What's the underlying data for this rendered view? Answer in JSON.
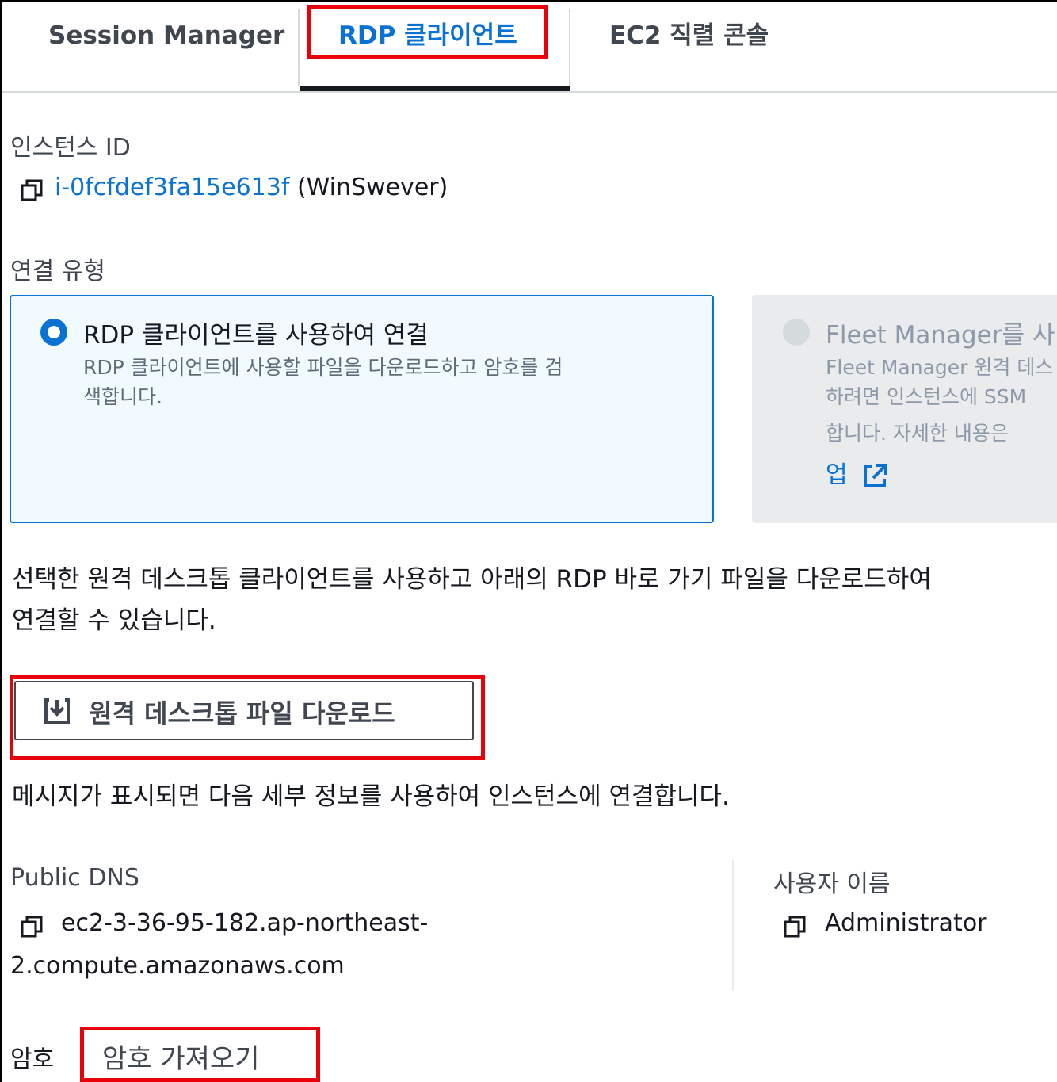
{
  "tabs": [
    {
      "label": "Session Manager"
    },
    {
      "label": "RDP 클라이언트"
    },
    {
      "label": "EC2 직렬 콘솔"
    }
  ],
  "instance": {
    "label": "인스턴스 ID",
    "id": "i-0fcfdef3fa15e613f",
    "name": "(WinSwever)"
  },
  "connection": {
    "label": "연결 유형",
    "option_rdp": {
      "title": "RDP 클라이언트를 사용하여 연결",
      "desc_line1": "RDP 클라이언트에 사용할 파일을 다운로드하고 암호를 검",
      "desc_line2": "색합니다."
    },
    "option_fleet": {
      "title": "Fleet Manager를 사",
      "desc_line1": "Fleet Manager 원격 데스",
      "desc_line2": "하려면 인스턴스에 SSM",
      "desc_line3": "합니다. 자세한 내용은 ",
      "link": "업"
    }
  },
  "instructions": {
    "line1": "선택한 원격 데스크톱 클라이언트를 사용하고 아래의 RDP 바로 가기 파일을 다운로드하여",
    "line2": "연결할 수 있습니다."
  },
  "download_button": {
    "label": "원격 데스크톱 파일 다운로드",
    "icon": "download-icon"
  },
  "prompt_text": "메시지가 표시되면 다음 세부 정보를 사용하여 인스턴스에 연결합니다.",
  "details": {
    "dns_label": "Public DNS",
    "dns_line1": "ec2-3-36-95-182.ap-northeast-",
    "dns_line2": "2.compute.amazonaws.com",
    "user_label": "사용자 이름",
    "user_value": "Administrator"
  },
  "password": {
    "label": "암호",
    "link": "암호 가져오기"
  },
  "colors": {
    "accent": "#0972d3",
    "highlight": "#e8000b"
  }
}
